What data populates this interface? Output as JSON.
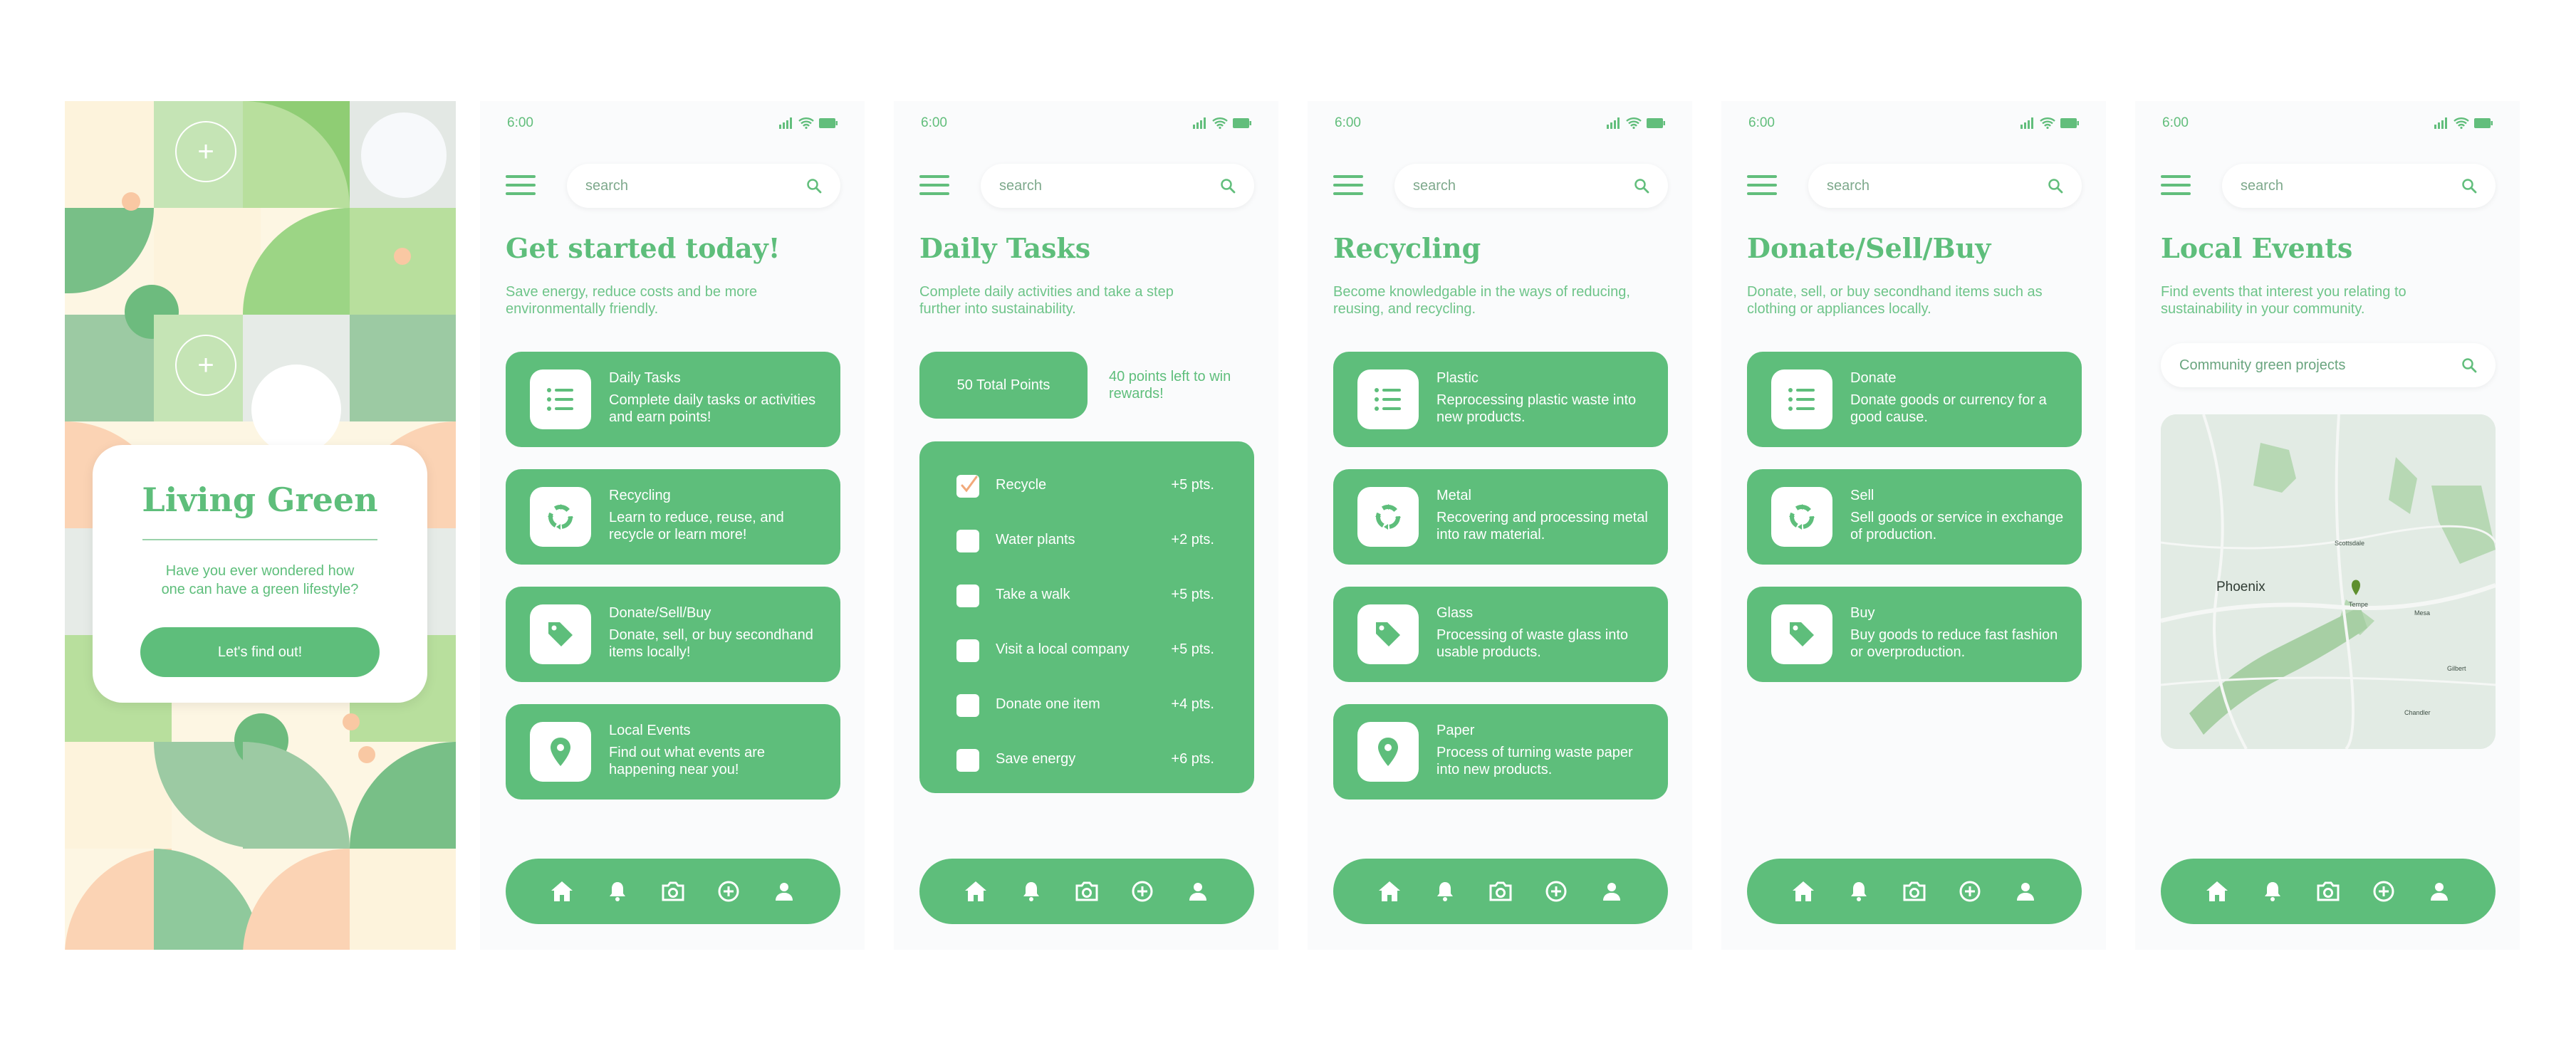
{
  "splash": {
    "title": "Living Green",
    "text": "Have you ever wondered how one can have a green lifestyle?",
    "button": "Let's find out!"
  },
  "status": {
    "time": "6:00"
  },
  "search": {
    "placeholder": "search"
  },
  "screens": {
    "home": {
      "title": "Get started today!",
      "subtitle": "Save energy, reduce costs and be more environmentally friendly.",
      "items": [
        {
          "title": "Daily Tasks",
          "desc": "Complete daily tasks or activities and earn points!",
          "icon": "list-icon"
        },
        {
          "title": "Recycling",
          "desc": "Learn to reduce, reuse, and recycle or learn more!",
          "icon": "recycle-icon"
        },
        {
          "title": "Donate/Sell/Buy",
          "desc": "Donate, sell, or buy secondhand items locally!",
          "icon": "tag-icon"
        },
        {
          "title": "Local Events",
          "desc": "Find out what events are happening near you!",
          "icon": "location-pin-icon"
        }
      ]
    },
    "tasks": {
      "title": "Daily Tasks",
      "subtitle": "Complete daily activities and take a step further into sustainability.",
      "points_total": "50 Total Points",
      "points_left": "40 points left to win rewards!",
      "list": [
        {
          "label": "Recycle",
          "pts": "+5 pts.",
          "checked": true
        },
        {
          "label": "Water plants",
          "pts": "+2 pts.",
          "checked": false
        },
        {
          "label": "Take a walk",
          "pts": "+5 pts.",
          "checked": false
        },
        {
          "label": "Visit a local company",
          "pts": "+5 pts.",
          "checked": false
        },
        {
          "label": "Donate one item",
          "pts": "+4 pts.",
          "checked": false
        },
        {
          "label": "Save energy",
          "pts": "+6 pts.",
          "checked": false
        }
      ]
    },
    "recycling": {
      "title": "Recycling",
      "subtitle": "Become knowledgable in the ways of reducing, reusing, and recycling.",
      "items": [
        {
          "title": "Plastic",
          "desc": "Reprocessing plastic waste into new products.",
          "icon": "list-icon"
        },
        {
          "title": "Metal",
          "desc": "Recovering and processing metal into raw material.",
          "icon": "recycle-icon"
        },
        {
          "title": "Glass",
          "desc": "Processing of waste glass into usable products.",
          "icon": "tag-icon"
        },
        {
          "title": "Paper",
          "desc": "Process of turning waste paper into new products.",
          "icon": "location-pin-icon"
        }
      ]
    },
    "donate": {
      "title": "Donate/Sell/Buy",
      "subtitle": "Donate, sell, or buy secondhand items such as clothing or appliances locally.",
      "items": [
        {
          "title": "Donate",
          "desc": "Donate goods or currency for a good cause.",
          "icon": "list-icon"
        },
        {
          "title": "Sell",
          "desc": "Sell goods or service in exchange of production.",
          "icon": "recycle-icon"
        },
        {
          "title": "Buy",
          "desc": "Buy goods to reduce fast fashion or overproduction.",
          "icon": "tag-icon"
        }
      ]
    },
    "events": {
      "title": "Local Events",
      "subtitle": "Find events that interest you relating to sustainability in your community.",
      "search_value": "Community green projects",
      "map_labels": [
        "Phoenix",
        "Scottsdale",
        "Tempe",
        "Mesa",
        "Gilbert",
        "Chandler"
      ]
    }
  },
  "nav": [
    "home-icon",
    "bell-icon",
    "camera-icon",
    "plus-circle-icon",
    "user-icon"
  ],
  "colors": {
    "primary": "#5ebe7b",
    "background": "#fafbfc",
    "accent_peach": "#fbd3b4",
    "cream": "#fdf6e3"
  }
}
